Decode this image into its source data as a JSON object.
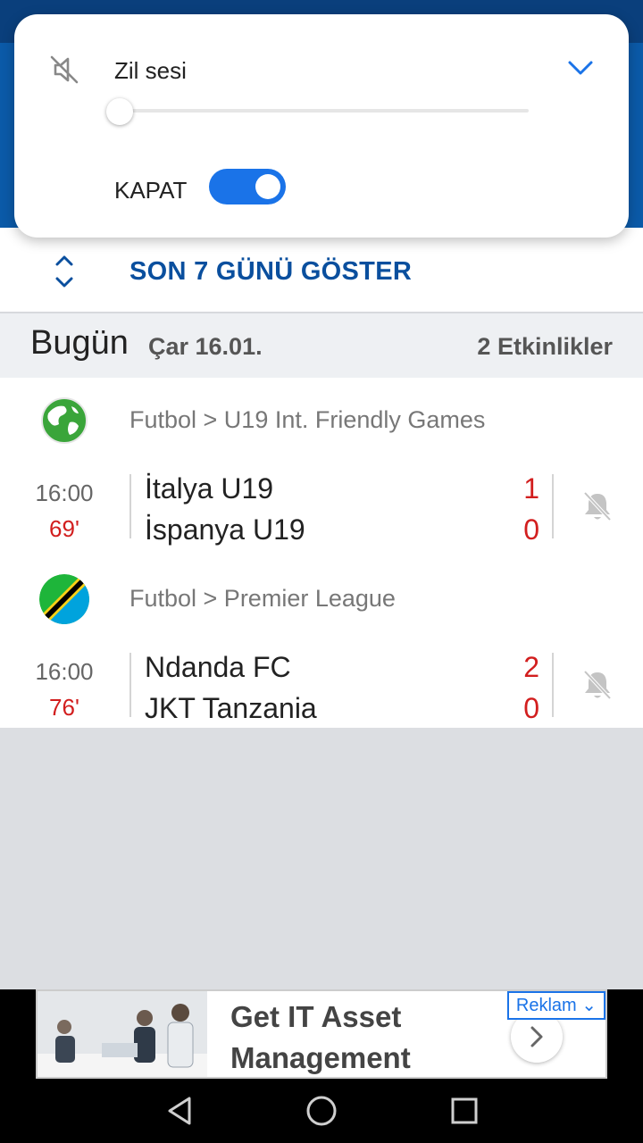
{
  "status_bar": {
    "left_text": "",
    "right_text": ""
  },
  "volume_panel": {
    "label": "Zil sesi",
    "level": 0,
    "toggle_label": "KAPAT",
    "toggle_on": true,
    "icons": {
      "mute": "mute-icon",
      "expand": "chevron-down-icon"
    }
  },
  "show_last_days": {
    "label": "SON 7 GÜNÜ GÖSTER",
    "icon": "up-down-arrows-icon"
  },
  "day_header": {
    "name": "Bugün",
    "date": "Çar 16.01.",
    "count": "2 Etkinlikler"
  },
  "leagues": [
    {
      "name": "Futbol > U19 Int. Friendly Games",
      "flag": "world-globe-icon",
      "match": {
        "time": "16:00",
        "minute": "69'",
        "home": "İtalya U19",
        "away": "İspanya U19",
        "home_score": "1",
        "away_score": "0"
      }
    },
    {
      "name": "Futbol > Premier League",
      "flag": "tanzania-flag-icon",
      "match": {
        "time": "16:00",
        "minute": "76'",
        "home": "Ndanda FC",
        "away": "JKT Tanzania",
        "home_score": "2",
        "away_score": "0"
      }
    }
  ],
  "ad": {
    "text": "Get IT Asset Management",
    "badge": "Reklam ⌄"
  },
  "colors": {
    "brand_blue": "#0b5aa8",
    "accent_blue": "#1a73e8",
    "live_red": "#d21e1e"
  }
}
